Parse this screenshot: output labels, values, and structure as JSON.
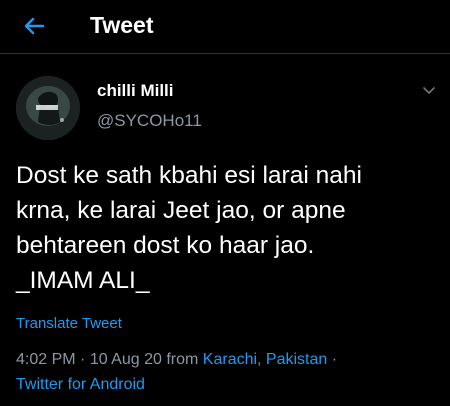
{
  "header": {
    "title": "Tweet",
    "back_icon": "arrow-left-icon"
  },
  "author": {
    "display_name": "chilli Milli",
    "handle": "@SYCOHo11",
    "avatar_icon": "profile-photo"
  },
  "tweet": {
    "lines": [
      "Dost ke sath kbahi esi larai nahi",
      "krna, ke larai Jeet jao, or apne",
      "behtareen dost ko haar jao.",
      "_IMAM ALI_"
    ],
    "translate_label": "Translate Tweet",
    "time": "4:02 PM",
    "separator": " · ",
    "date_from": "10 Aug 20 from ",
    "location": "Karachi, Pakistan",
    "separator2": " ·",
    "source": "Twitter for Android"
  },
  "colors": {
    "background": "#000000",
    "accent": "#1d9bf0",
    "muted": "#8b98a5",
    "text": "#ffffff"
  }
}
